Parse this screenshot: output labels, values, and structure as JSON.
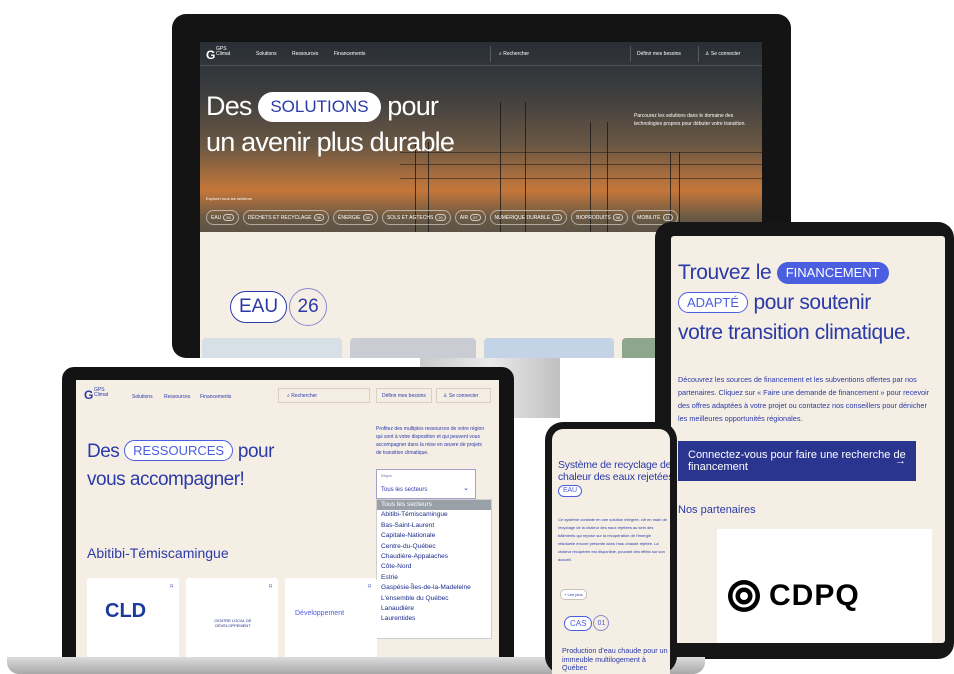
{
  "desktop": {
    "logo_mark": "G",
    "logo_text_1": "GPS",
    "logo_text_2": "Climat",
    "nav": [
      "Solutions",
      "Ressources",
      "Financements"
    ],
    "search_placeholder": "Rechercher",
    "define_label": "Définir mes besoins",
    "login_label": "Se connecter",
    "hero_pre": "Des",
    "hero_pill": "SOLUTIONS",
    "hero_post": "pour",
    "hero_line2": "un avenir plus durable",
    "hero_desc": "Parcourez les solutions dans le domaine des technologies propres pour débuter votre transition.",
    "explore_label": "Explorer tous les secteurs",
    "chips": [
      {
        "label": "EAU",
        "count": "26"
      },
      {
        "label": "DÉCHETS ET RECYCLAGE",
        "count": "36"
      },
      {
        "label": "ÉNERGIE",
        "count": "30"
      },
      {
        "label": "SOLS ET AGTECHS",
        "count": "20"
      },
      {
        "label": "AIR",
        "count": "07"
      },
      {
        "label": "NUMÉRIQUE DURABLE",
        "count": "11"
      },
      {
        "label": "BIOPRODUITS",
        "count": "08"
      },
      {
        "label": "MOBILITÉ",
        "count": "11"
      }
    ],
    "section_pill": "EAU",
    "section_count": "26"
  },
  "tablet": {
    "h1_pre": "Trouvez le",
    "h1_pill": "FINANCEMENT",
    "h1_pill2": "ADAPTÉ",
    "h1_post": "pour soutenir",
    "h1_line3": "votre transition climatique.",
    "paragraph": "Découvrez les sources de financement et les subventions offertes par nos partenaires. Cliquez sur « Faire une demande de financement » pour recevoir des offres adaptées à votre projet ou contactez nos conseillers pour dénicher les meilleures opportunités régionales.",
    "cta_label": "Connectez-vous pour faire une recherche de financement",
    "cta_arrow": "→",
    "partners_label": "Nos partenaires",
    "partner_logo_text": "CDPQ"
  },
  "laptop": {
    "logo_mark": "G",
    "logo_text_1": "GPS",
    "logo_text_2": "Climat",
    "nav": [
      "Solutions",
      "Ressources",
      "Financements"
    ],
    "search_placeholder": "Rechercher",
    "define_label": "Définir mes besoins",
    "login_label": "Se connecter",
    "hero_pre": "Des",
    "hero_pill": "RESSOURCES",
    "hero_post": "pour",
    "hero_line2": "vous accompagner!",
    "desc": "Profitez des multiples ressources de votre région qui sont à votre disposition et qui peuvent vous accompagner dans la mise en œuvre de projets de transition climatique.",
    "select_label": "Région",
    "select_value": "Tous les secteurs",
    "options": [
      "Tous les secteurs",
      "Abitibi-Témiscamingue",
      "Bas-Saint-Laurent",
      "Capitale-Nationale",
      "Centre-du-Québec",
      "Chaudière-Appalaches",
      "Côte-Nord",
      "Estrie",
      "Gaspésie-Îles-de-la-Madeleine",
      "L'ensemble du Québec",
      "Lanaudière",
      "Laurentides"
    ],
    "region_heading": "Abitibi-Témiscamingue",
    "card1_logo": "CLD",
    "card2_logo": "CENTRE LOCAL DE DÉVELOPPEMENT",
    "card3_logo": "Développement"
  },
  "phone": {
    "title": "Système de recyclage de la chaleur des eaux rejetées",
    "title_pill": "EAU",
    "body": "Ce système consiste en une solution intégrée, clé en main de recyclage de la chaleur des eaux rejetées au sein des bâtiments qui repose sur la récupération de l'énergie résiduelle encore présente dans l'eau chaude rejetée. La chaleur récupérée est disponible, pouvant des effets sur son accueil.",
    "more_label": "+ Lire plus",
    "cas_pill": "CAS",
    "cas_count": "01",
    "card_title": "Production d'eau chaude pour un immeuble multilogement à Québec"
  }
}
